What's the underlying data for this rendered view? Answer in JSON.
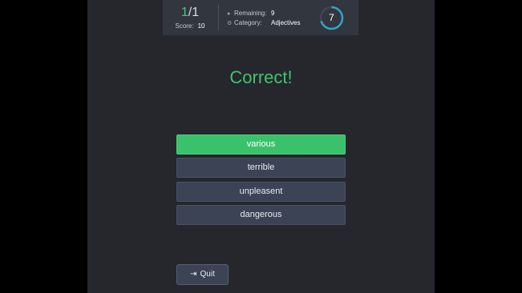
{
  "hud": {
    "progress_current": "1",
    "progress_separator": "/",
    "progress_total": "1",
    "score_label": "Score:",
    "score_value": "10",
    "remaining_label": "Remaining:",
    "remaining_value": "9",
    "category_label": "Category:",
    "category_value": "Adjectives",
    "timer_value": "7",
    "timer_fraction": 0.7
  },
  "feedback": {
    "text": "Correct!"
  },
  "answers": [
    {
      "label": "various",
      "state": "correct"
    },
    {
      "label": "terrible",
      "state": "default"
    },
    {
      "label": "unpleasent",
      "state": "default"
    },
    {
      "label": "dangerous",
      "state": "default"
    }
  ],
  "quit": {
    "label": "Quit",
    "icon": "exit-icon"
  },
  "colors": {
    "accent_green": "#3ac16c",
    "timer_ring": "#2fa6c7",
    "button_bg": "#3b4354"
  }
}
